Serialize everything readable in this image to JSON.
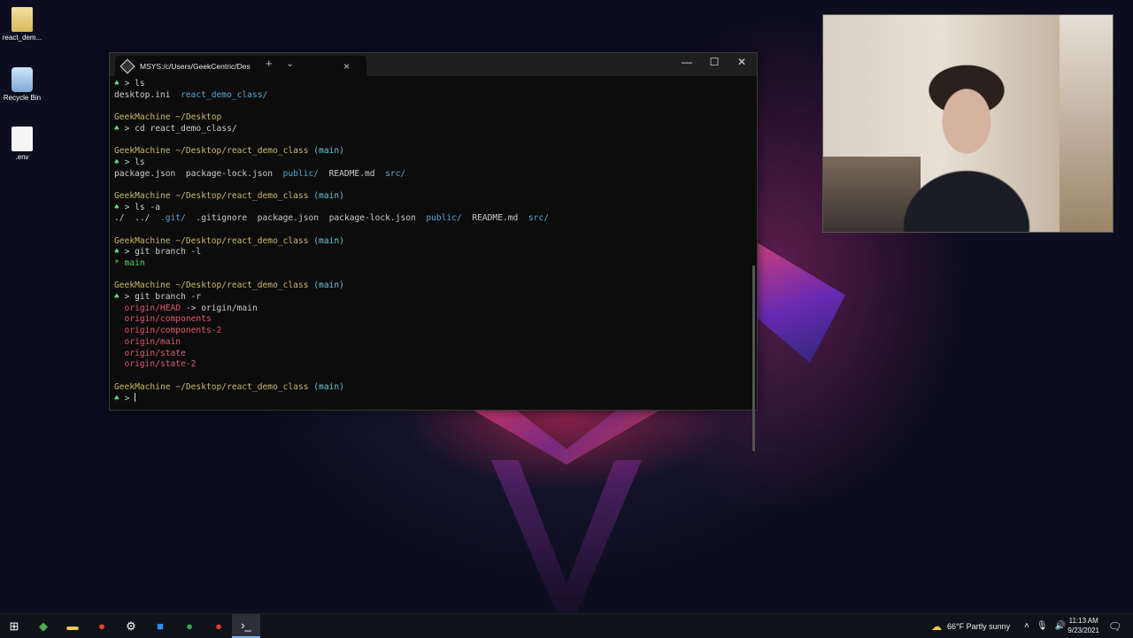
{
  "desktop": {
    "icons": [
      {
        "label": "react_dem...",
        "icon": "folder-icon"
      },
      {
        "label": "Recycle Bin",
        "icon": "recycle-bin-icon"
      },
      {
        "label": ".env",
        "icon": "file-icon"
      }
    ]
  },
  "window": {
    "tab_title": "MSYS:/c/Users/GeekCentric/Des",
    "new_tab": "+",
    "dropdown": "⌄",
    "tab_close": "×",
    "minimize": "—",
    "maximize": "☐",
    "close": "✕"
  },
  "terminal": {
    "lines": [
      {
        "p": "> ",
        "cmd": "ls"
      },
      {
        "a": "desktop.ini  ",
        "b": "react_demo_class/"
      },
      {},
      {
        "host": "GeekMachine",
        "path": " ~/Desktop"
      },
      {
        "p": "> ",
        "cmd": "cd react_demo_class/"
      },
      {},
      {
        "host": "GeekMachine",
        "path": " ~/Desktop/react_demo_class",
        "branch": " (main)"
      },
      {
        "p": "> ",
        "cmd": "ls"
      },
      {
        "a": "package.json  package-lock.json  ",
        "b": "public/",
        "c": "  README.md  ",
        "d": "src/"
      },
      {},
      {
        "host": "GeekMachine",
        "path": " ~/Desktop/react_demo_class",
        "branch": " (main)"
      },
      {
        "p": "> ",
        "cmd": "ls -a"
      },
      {
        "a": "./  ../  ",
        "b": ".git/",
        "c": "  .gitignore  package.json  package-lock.json  ",
        "d": "public/",
        "e": "  README.md  ",
        "f": "src/"
      },
      {},
      {
        "host": "GeekMachine",
        "path": " ~/Desktop/react_demo_class",
        "branch": " (main)"
      },
      {
        "p": "> ",
        "cmd": "git branch -l"
      },
      {
        "star": "* main"
      },
      {},
      {
        "host": "GeekMachine",
        "path": " ~/Desktop/react_demo_class",
        "branch": " (main)"
      },
      {
        "p": "> ",
        "cmd": "git branch -r"
      },
      {
        "r": "  origin/HEAD",
        "w": " -> origin/main"
      },
      {
        "r": "  origin/components"
      },
      {
        "r": "  origin/components-2"
      },
      {
        "r": "  origin/main"
      },
      {
        "r": "  origin/state"
      },
      {
        "r": "  origin/state-2"
      },
      {},
      {
        "host": "GeekMachine",
        "path": " ~/Desktop/react_demo_class",
        "branch": " (main)"
      },
      {
        "p": "> ",
        "cmd": "",
        "cursor": true
      }
    ]
  },
  "taskbar": {
    "start": "⊞",
    "apps": [
      "app-icon-green",
      "file-explorer-icon",
      "chrome-icon",
      "settings-icon",
      "zoom-icon",
      "browser-icon",
      "recorder-icon",
      "terminal-icon"
    ],
    "weather": "66°F  Partly sunny",
    "time": "11:13 AM",
    "date": "9/23/2021"
  }
}
